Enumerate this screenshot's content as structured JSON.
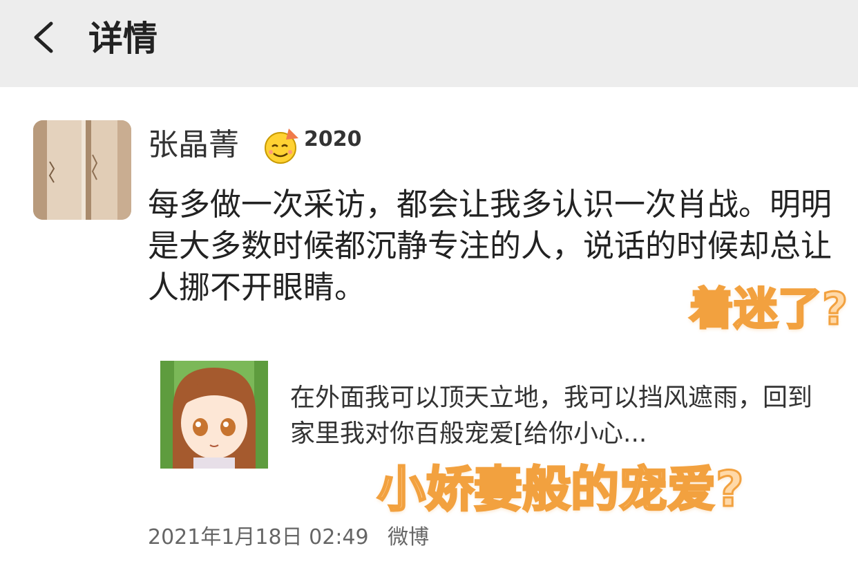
{
  "header": {
    "back_icon": "chevron-left-icon",
    "title": "详情"
  },
  "post": {
    "username": "张晶菁",
    "badge_icon": "party-face-icon",
    "badge_year": "2020",
    "text": "每多做一次采访，都会让我多认识一次肖战。明明是大多数时候都沉静专注的人，说话的时候却总让人挪不开眼睛。",
    "shared": {
      "thumbnail_icon": "cartoon-girl-avatar",
      "text": "在外面我可以顶天立地，我可以挡风遮雨，回到家里我对你百般宠爱[给你小心..."
    },
    "date": "2021年1月18日 02:49",
    "source": "微博"
  },
  "overlay_captions": {
    "caption_1": "着迷了?",
    "caption_2": "小娇妻般的宠爱?"
  },
  "colors": {
    "header_bg": "#ededed",
    "caption_fill": "#ffd9a8",
    "caption_stroke": "#f2a13f"
  }
}
